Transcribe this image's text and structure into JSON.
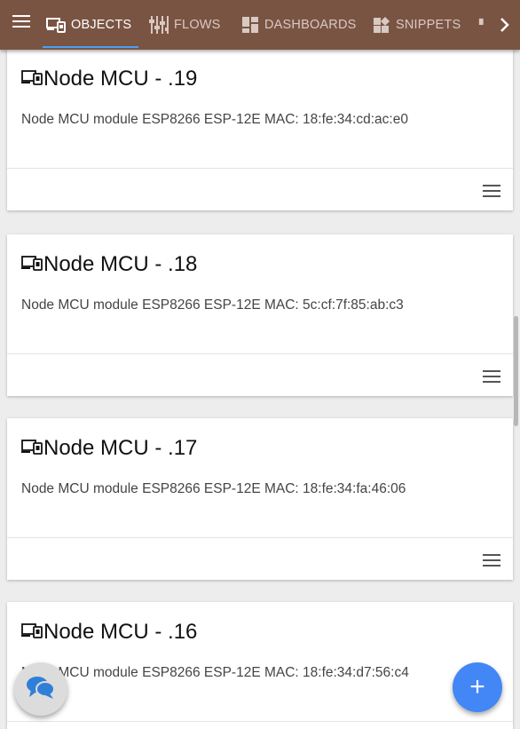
{
  "nav": {
    "tabs": [
      {
        "label": "OBJECTS",
        "icon": "devices-icon",
        "active": true
      },
      {
        "label": "FLOWS",
        "icon": "sliders-icon",
        "active": false
      },
      {
        "label": "DASHBOARDS",
        "icon": "dashboard-icon",
        "active": false
      },
      {
        "label": "SNIPPETS",
        "icon": "widgets-icon",
        "active": false
      }
    ],
    "accent_color": "#4a9ff5",
    "bar_color": "#7a5443"
  },
  "cards": [
    {
      "title": "Node MCU - .19",
      "description": "Node MCU module ESP8266 ESP-12E MAC: 18:fe:34:cd:ac:e0"
    },
    {
      "title": "Node MCU - .18",
      "description": "Node MCU module ESP8266 ESP-12E MAC: 5c:cf:7f:85:ab:c3"
    },
    {
      "title": "Node MCU - .17",
      "description": "Node MCU module ESP8266 ESP-12E MAC: 18:fe:34:fa:46:06"
    },
    {
      "title": "Node MCU - .16",
      "description": "Node MCU module ESP8266 ESP-12E MAC: 18:fe:34:d7:56:c4"
    }
  ],
  "fab": {
    "add_label": "+",
    "add_color": "#4287f5"
  }
}
